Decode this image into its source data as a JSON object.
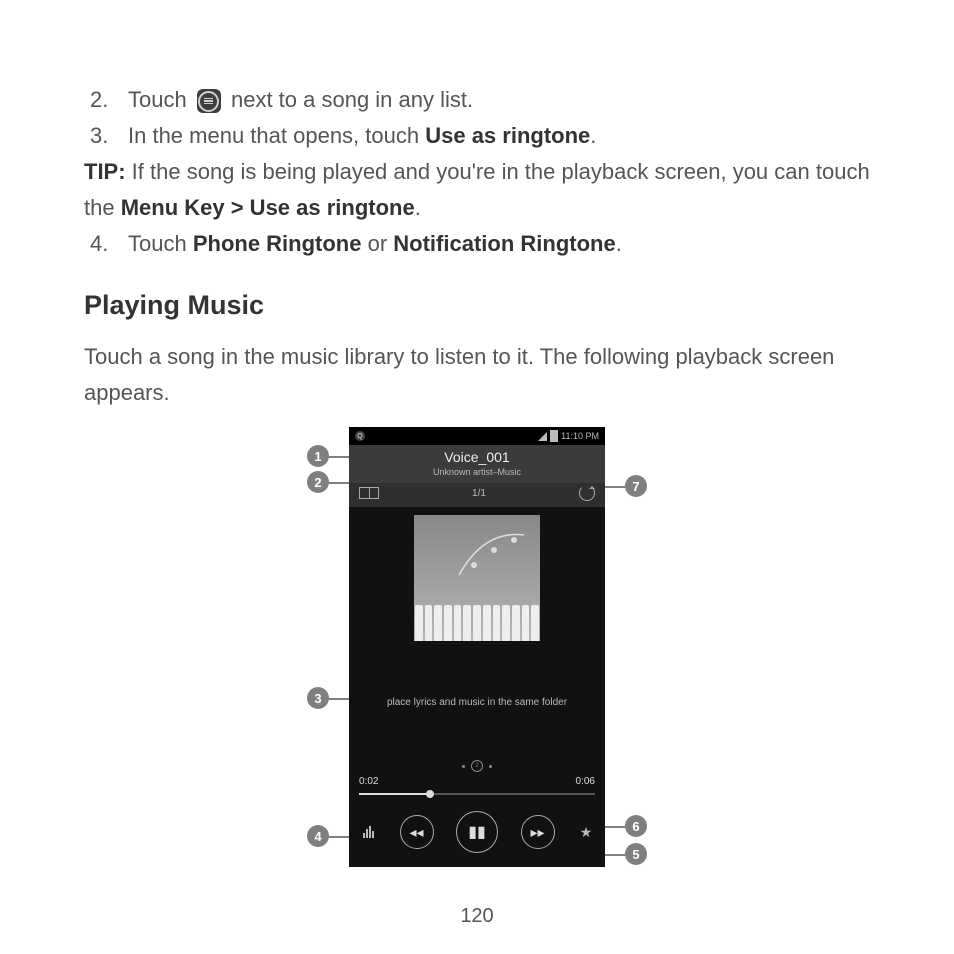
{
  "steps": {
    "s2_num": "2.",
    "s2a": "Touch",
    "s2b": "next to a song in any list.",
    "s3_num": "3.",
    "s3a": "In the menu that opens, touch ",
    "s3b": "Use as ringtone",
    "s3c": ".",
    "tip_label": "TIP:",
    "tip_a": " If the song is being played and you're in the playback screen, you can touch the ",
    "tip_b": "Menu Key > Use as ringtone",
    "tip_c": ".",
    "s4_num": "4.",
    "s4a": "Touch ",
    "s4b": "Phone Ringtone",
    "s4c": " or ",
    "s4d": "Notification Ringtone",
    "s4e": "."
  },
  "heading": "Playing Music",
  "intro": "Touch a song in the music library to listen to it. The following playback screen appears.",
  "phone": {
    "time": "11:10 PM",
    "track": "Voice_001",
    "subtitle": "Unknown artist–Music",
    "counter": "1/1",
    "lyrics": "place lyrics and music in the same folder",
    "t_elapsed": "0:02",
    "t_total": "0:06",
    "dot_mid": "2"
  },
  "callouts": {
    "c1": "1",
    "c2": "2",
    "c3": "3",
    "c4": "4",
    "c5": "5",
    "c6": "6",
    "c7": "7"
  },
  "pagenum": "120"
}
